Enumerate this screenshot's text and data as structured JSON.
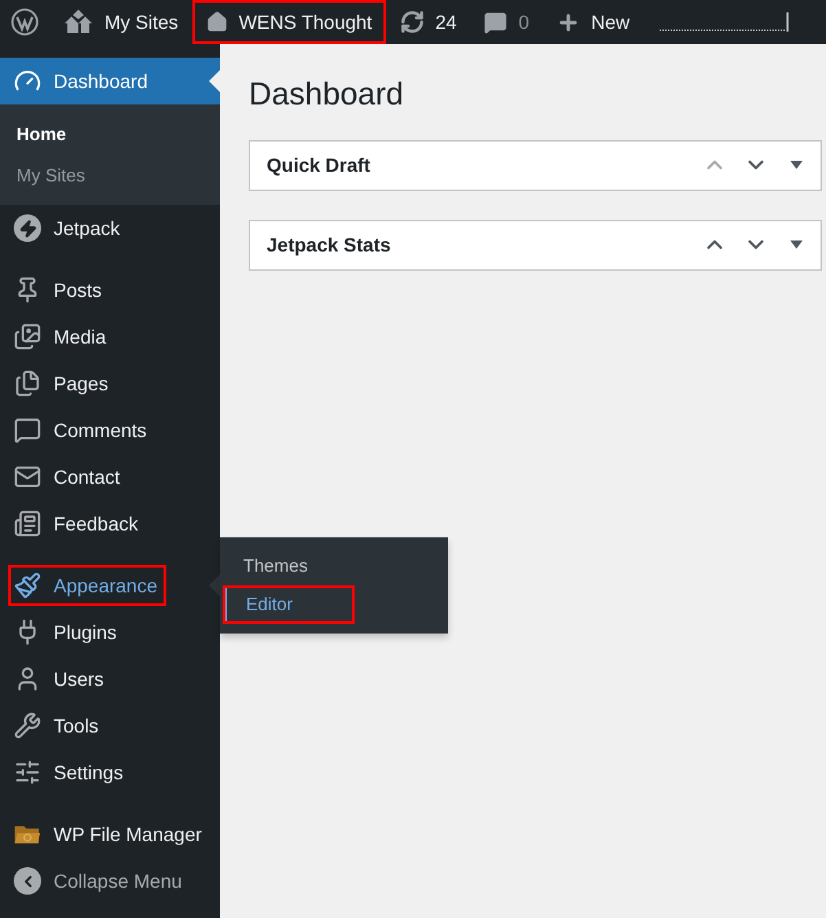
{
  "admin_bar": {
    "items": [
      {
        "kind": "logo"
      },
      {
        "kind": "sites",
        "label": "My Sites",
        "highlighted": false
      },
      {
        "kind": "site",
        "label": "WENS Thought",
        "highlighted": true
      },
      {
        "kind": "updates",
        "label": "24",
        "highlighted": false
      },
      {
        "kind": "comments",
        "label": "0",
        "highlighted": false
      },
      {
        "kind": "new",
        "label": "New",
        "highlighted": false
      }
    ]
  },
  "sidebar": {
    "groups": [
      {
        "items": [
          {
            "kind": "dashboard",
            "label": "Dashboard",
            "selected": true,
            "hovered": false,
            "highlighted": false,
            "children": [
              {
                "label": "Home",
                "selected": true
              },
              {
                "label": "My Sites",
                "selected": false
              }
            ]
          },
          {
            "kind": "jetpack",
            "label": "Jetpack",
            "selected": false,
            "hovered": false,
            "highlighted": false
          }
        ]
      },
      {
        "items": [
          {
            "kind": "posts",
            "label": "Posts",
            "selected": false,
            "hovered": false,
            "highlighted": false
          },
          {
            "kind": "media",
            "label": "Media",
            "selected": false,
            "hovered": false,
            "highlighted": false
          },
          {
            "kind": "pages",
            "label": "Pages",
            "selected": false,
            "hovered": false,
            "highlighted": false
          },
          {
            "kind": "comments",
            "label": "Comments",
            "selected": false,
            "hovered": false,
            "highlighted": false
          },
          {
            "kind": "contact",
            "label": "Contact",
            "selected": false,
            "hovered": false,
            "highlighted": false
          },
          {
            "kind": "feedback",
            "label": "Feedback",
            "selected": false,
            "hovered": false,
            "highlighted": false
          }
        ]
      },
      {
        "items": [
          {
            "kind": "appearance",
            "label": "Appearance",
            "selected": false,
            "hovered": true,
            "highlighted": true,
            "flyout": [
              {
                "label": "Themes",
                "selected": false,
                "highlighted": false
              },
              {
                "label": "Editor",
                "selected": true,
                "highlighted": true
              }
            ]
          },
          {
            "kind": "plugins",
            "label": "Plugins",
            "selected": false,
            "hovered": false,
            "highlighted": false
          },
          {
            "kind": "users",
            "label": "Users",
            "selected": false,
            "hovered": false,
            "highlighted": false
          },
          {
            "kind": "tools",
            "label": "Tools",
            "selected": false,
            "hovered": false,
            "highlighted": false
          },
          {
            "kind": "settings",
            "label": "Settings",
            "selected": false,
            "hovered": false,
            "highlighted": false
          }
        ]
      },
      {
        "items": [
          {
            "kind": "filemanager",
            "label": "WP File Manager",
            "selected": false,
            "hovered": false,
            "highlighted": false
          },
          {
            "kind": "collapse",
            "label": "Collapse Menu",
            "selected": false,
            "hovered": false,
            "highlighted": false
          }
        ]
      }
    ]
  },
  "main": {
    "title": "Dashboard",
    "panels": [
      {
        "title": "Quick Draft",
        "move_up_disabled": true
      },
      {
        "title": "Jetpack Stats",
        "move_up_disabled": false
      }
    ]
  }
}
